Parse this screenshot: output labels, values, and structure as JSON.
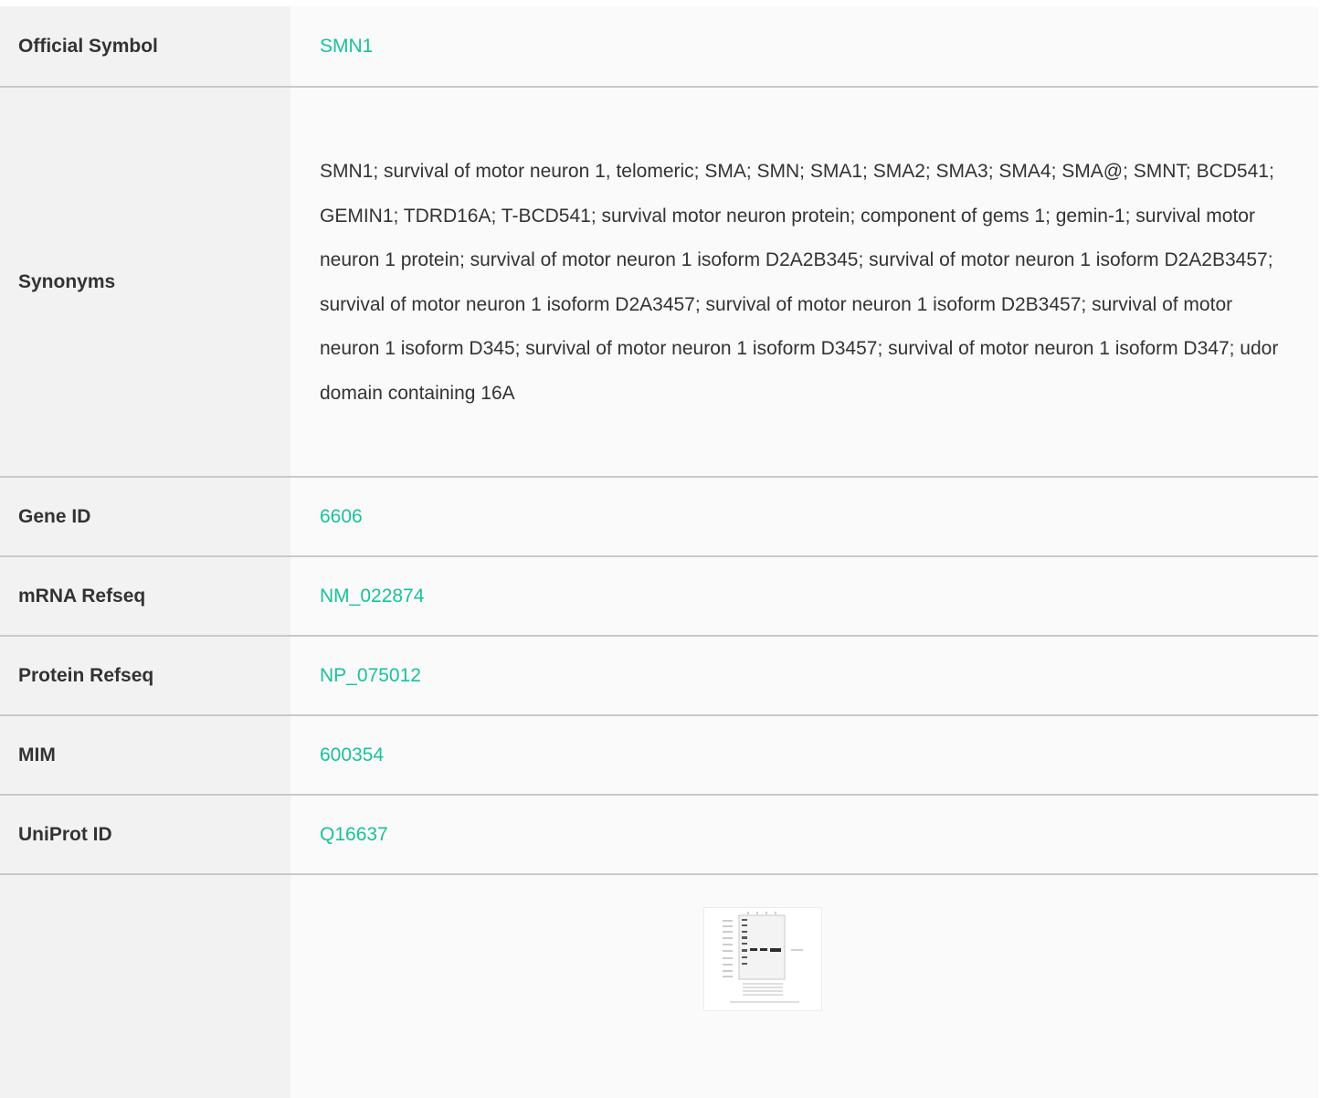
{
  "rows": [
    {
      "label": "Official Symbol",
      "value": "SMN1"
    },
    {
      "label": "Synonyms",
      "value": "SMN1; survival of motor neuron 1, telomeric; SMA; SMN; SMA1; SMA2; SMA3; SMA4; SMA@; SMNT; BCD541; GEMIN1; TDRD16A; T-BCD541; survival motor neuron protein; component of gems 1; gemin-1; survival motor neuron 1 protein; survival of motor neuron 1 isoform D2A2B345; survival of motor neuron 1 isoform D2A2B3457; survival of motor neuron 1 isoform D2A3457; survival of motor neuron 1 isoform D2B3457; survival of motor neuron 1 isoform D345; survival of motor neuron 1 isoform D3457; survival of motor neuron 1 isoform D347; udor domain containing 16A"
    },
    {
      "label": "Gene ID",
      "value": "6606"
    },
    {
      "label": "mRNA Refseq",
      "value": "NM_022874"
    },
    {
      "label": "Protein Refseq",
      "value": "NP_075012"
    },
    {
      "label": "MIM",
      "value": "600354"
    },
    {
      "label": "UniProt ID",
      "value": "Q16637"
    }
  ],
  "colors": {
    "link": "#19c29a",
    "label_bg": "#f2f2f2",
    "value_bg": "#fafafa",
    "border": "#c9c9c9"
  }
}
